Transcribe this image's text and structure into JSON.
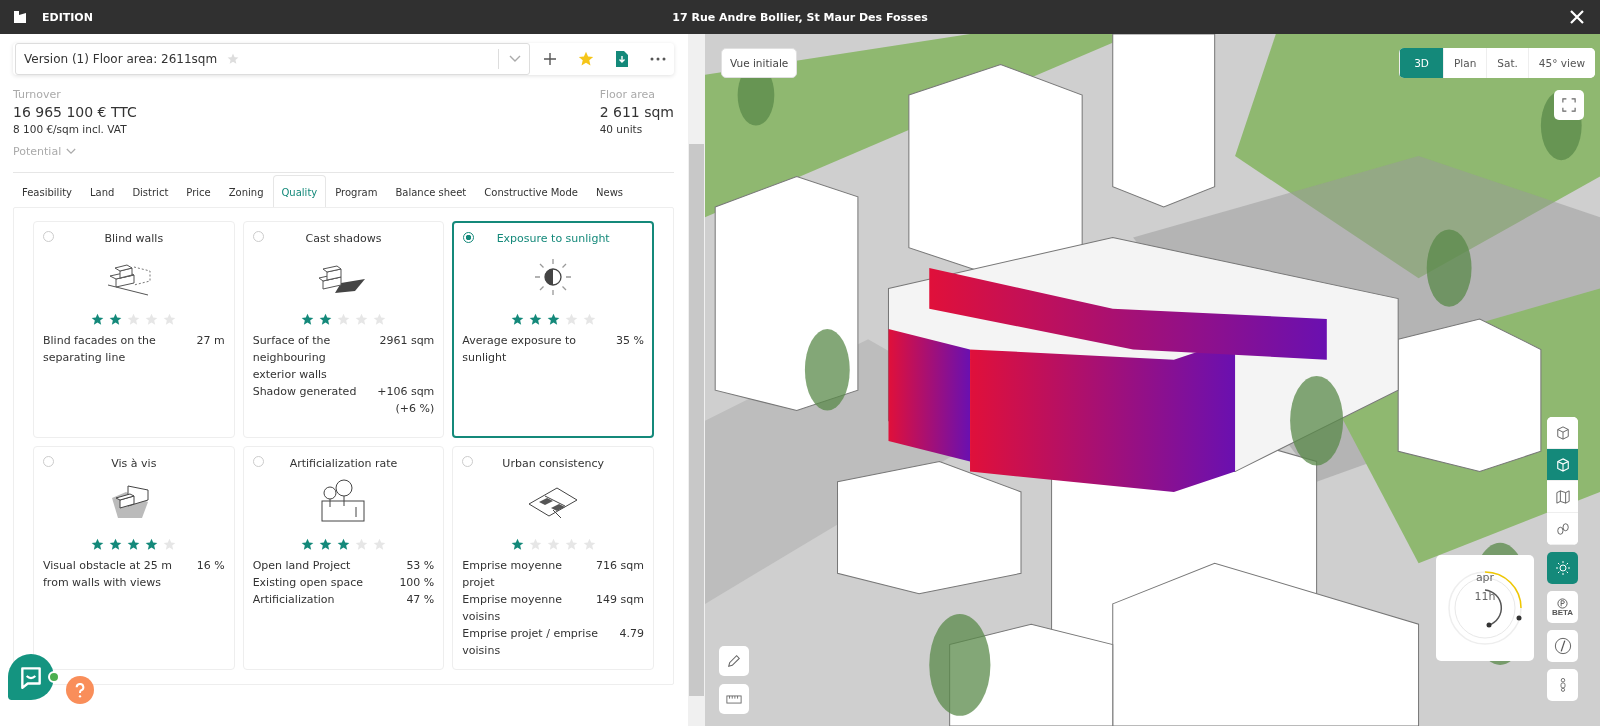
{
  "header": {
    "title": "EDITION",
    "address": "17 Rue Andre Bollier, St Maur Des Fosses"
  },
  "version": {
    "label": "Version (1) Floor area: 2611sqm",
    "starred": false
  },
  "summary": {
    "turnover_label": "Turnover",
    "turnover": "16 965 100 € TTC",
    "turnover_sub": "8 100 €/sqm incl. VAT",
    "area_label": "Floor area",
    "area": "2 611 sqm",
    "area_sub": "40 units",
    "potential": "Potential"
  },
  "tabs": [
    {
      "label": "Feasibility",
      "selected": false
    },
    {
      "label": "Land",
      "selected": false
    },
    {
      "label": "District",
      "selected": false
    },
    {
      "label": "Price",
      "selected": false
    },
    {
      "label": "Zoning",
      "selected": false
    },
    {
      "label": "Quality",
      "selected": true
    },
    {
      "label": "Program",
      "selected": false
    },
    {
      "label": "Balance sheet",
      "selected": false
    },
    {
      "label": "Constructive Mode",
      "selected": false
    },
    {
      "label": "News",
      "selected": false
    }
  ],
  "cards": [
    {
      "title": "Blind walls",
      "kind": "blind-walls",
      "selected": false,
      "stars": 2,
      "metrics": [
        {
          "label": "Blind facades on the separating line",
          "value": "27 m"
        }
      ]
    },
    {
      "title": "Cast shadows",
      "kind": "shadows",
      "selected": false,
      "stars": 2,
      "metrics": [
        {
          "label": "Surface of the neighbouring exterior walls",
          "value": "2961 sqm"
        },
        {
          "label": "Shadow generated",
          "value": "+106 sqm",
          "note": "(+6 %)"
        }
      ]
    },
    {
      "title": "Exposure to sunlight",
      "kind": "sunlight",
      "selected": true,
      "stars": 3,
      "metrics": [
        {
          "label": "Average exposure to sunlight",
          "value": "35 %"
        }
      ]
    },
    {
      "title": "Vis à vis",
      "kind": "vis-a-vis",
      "selected": false,
      "stars": 4,
      "metrics": [
        {
          "label": "Visual obstacle at 25 m from walls with views",
          "value": "16 %"
        }
      ]
    },
    {
      "title": "Artificialization rate",
      "kind": "artificialization",
      "selected": false,
      "stars": 3,
      "metrics": [
        {
          "label": "Open land Project",
          "value": "53 %"
        },
        {
          "label": "Existing open space",
          "value": "100 %"
        },
        {
          "label": "Artificialization",
          "value": "47 %"
        }
      ]
    },
    {
      "title": "Urban consistency",
      "kind": "urban",
      "selected": false,
      "stars": 1,
      "metrics": [
        {
          "label": "Emprise moyenne projet",
          "value": "716 sqm"
        },
        {
          "label": "Emprise moyenne voisins",
          "value": "149 sqm"
        },
        {
          "label": "Emprise projet / emprise voisins",
          "value": "4.79"
        }
      ]
    }
  ],
  "map": {
    "reset": "Vue initiale",
    "views": [
      {
        "label": "3D",
        "selected": true
      },
      {
        "label": "Plan",
        "selected": false
      },
      {
        "label": "Sat.",
        "selected": false
      },
      {
        "label": "45° view",
        "selected": false
      }
    ],
    "tools": [
      {
        "kind": "cube-outline",
        "selected": false
      },
      {
        "kind": "cube",
        "selected": true
      },
      {
        "kind": "map",
        "selected": false
      },
      {
        "kind": "footprints",
        "selected": false
      }
    ],
    "sun_tool": {
      "selected": true,
      "month": "apr",
      "hour": "11h",
      "level": 0.25
    },
    "extra_tools": [
      {
        "kind": "parking",
        "label": "BETA"
      },
      {
        "kind": "compass"
      },
      {
        "kind": "person"
      }
    ]
  }
}
